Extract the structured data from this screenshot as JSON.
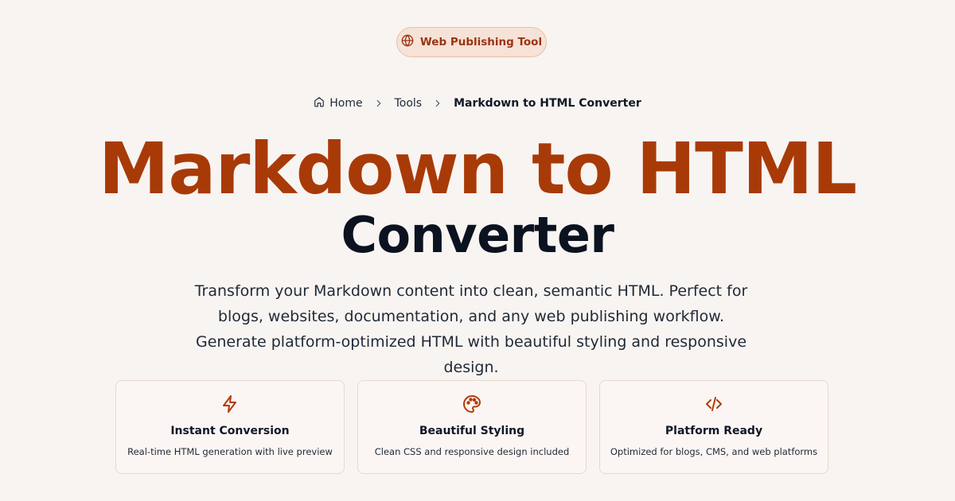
{
  "badge": {
    "label": "Web Publishing Tool",
    "icon": "globe-icon"
  },
  "breadcrumb": {
    "home": "Home",
    "tools": "Tools",
    "current": "Markdown to HTML Converter"
  },
  "hero": {
    "title_line1": "Markdown to HTML",
    "title_line2": "Converter",
    "description": "Transform your Markdown content into clean, semantic HTML. Perfect for blogs, websites, documentation, and any web publishing workflow. Generate platform-optimized HTML with beautiful styling and responsive design."
  },
  "features": [
    {
      "icon": "lightning-icon",
      "title": "Instant Conversion",
      "text": "Real-time HTML generation with live preview"
    },
    {
      "icon": "palette-icon",
      "title": "Beautiful Styling",
      "text": "Clean CSS and responsive design included"
    },
    {
      "icon": "code-icon",
      "title": "Platform Ready",
      "text": "Optimized for blogs, CMS, and web platforms"
    }
  ],
  "colors": {
    "accent": "#a83a08",
    "background": "#f8f4f1",
    "badge_bg": "#f6e2d6"
  }
}
